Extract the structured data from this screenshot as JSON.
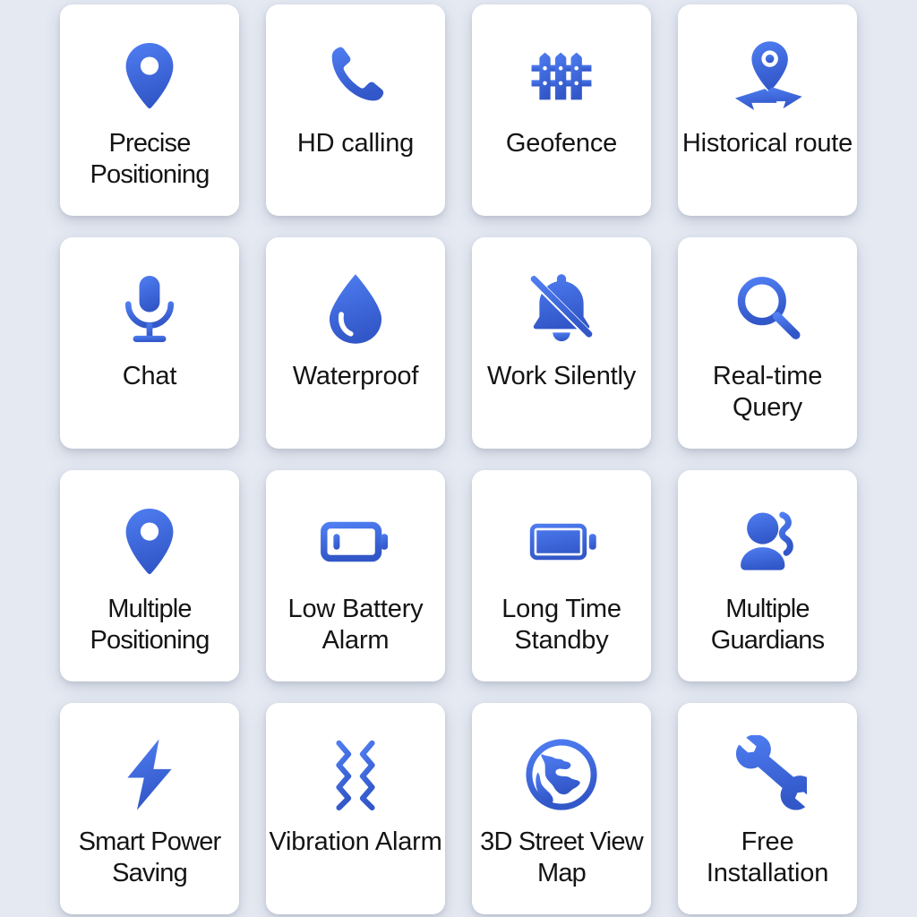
{
  "page": {
    "title": "GPS Tracker Feature Grid",
    "background_color": "#e4e9f2",
    "card_color": "#ffffff",
    "icon_gradient_start": "#4f7ef2",
    "icon_gradient_end": "#3257c8",
    "text_color": "#141414",
    "columns": 4,
    "rows": 4
  },
  "features": [
    {
      "label": "Precise Positioning",
      "icon": "location-pin-icon"
    },
    {
      "label": "HD calling",
      "icon": "phone-handset-icon"
    },
    {
      "label": "Geofence",
      "icon": "fence-icon"
    },
    {
      "label": "Historical route",
      "icon": "route-pin-icon"
    },
    {
      "label": "Chat",
      "icon": "microphone-icon"
    },
    {
      "label": "Waterproof",
      "icon": "water-drop-icon"
    },
    {
      "label": "Work Silently",
      "icon": "bell-muted-icon"
    },
    {
      "label": "Real-time Query",
      "icon": "magnifier-icon"
    },
    {
      "label": "Multiple Positioning",
      "icon": "location-pin-icon"
    },
    {
      "label": "Low Battery Alarm",
      "icon": "battery-low-icon"
    },
    {
      "label": "Long Time Standby",
      "icon": "battery-full-icon"
    },
    {
      "label": "Multiple Guardians",
      "icon": "people-icon"
    },
    {
      "label": "Smart Power Saving",
      "icon": "lightning-bolt-icon"
    },
    {
      "label": "Vibration Alarm",
      "icon": "vibration-waves-icon"
    },
    {
      "label": "3D Street View Map",
      "icon": "globe-icon"
    },
    {
      "label": "Free Installation",
      "icon": "wrench-icon"
    }
  ]
}
